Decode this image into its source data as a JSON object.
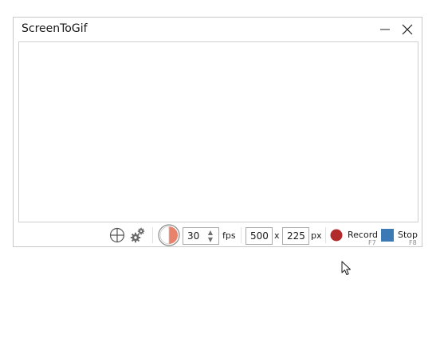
{
  "window": {
    "title": "ScreenToGif"
  },
  "icons": {
    "minimize": "minimize-icon",
    "close": "close-icon",
    "crosshair": "crosshair-icon",
    "settings": "gears-icon",
    "frame_rate_mode": "half-circle-icon",
    "record": "record-dot-icon",
    "stop": "stop-square-icon",
    "pointer": "mouse-pointer-icon"
  },
  "toolbar": {
    "fps_value": "30",
    "fps_unit": "fps",
    "width_value": "500",
    "size_separator": "x",
    "height_value": "225",
    "size_unit": "px",
    "record_label": "Record",
    "record_shortcut": "F7",
    "stop_label": "Stop",
    "stop_shortcut": "F8"
  },
  "colors": {
    "record": "#b22b2b",
    "stop": "#3b7ab4",
    "half_circle_fill": "#e8826b"
  }
}
